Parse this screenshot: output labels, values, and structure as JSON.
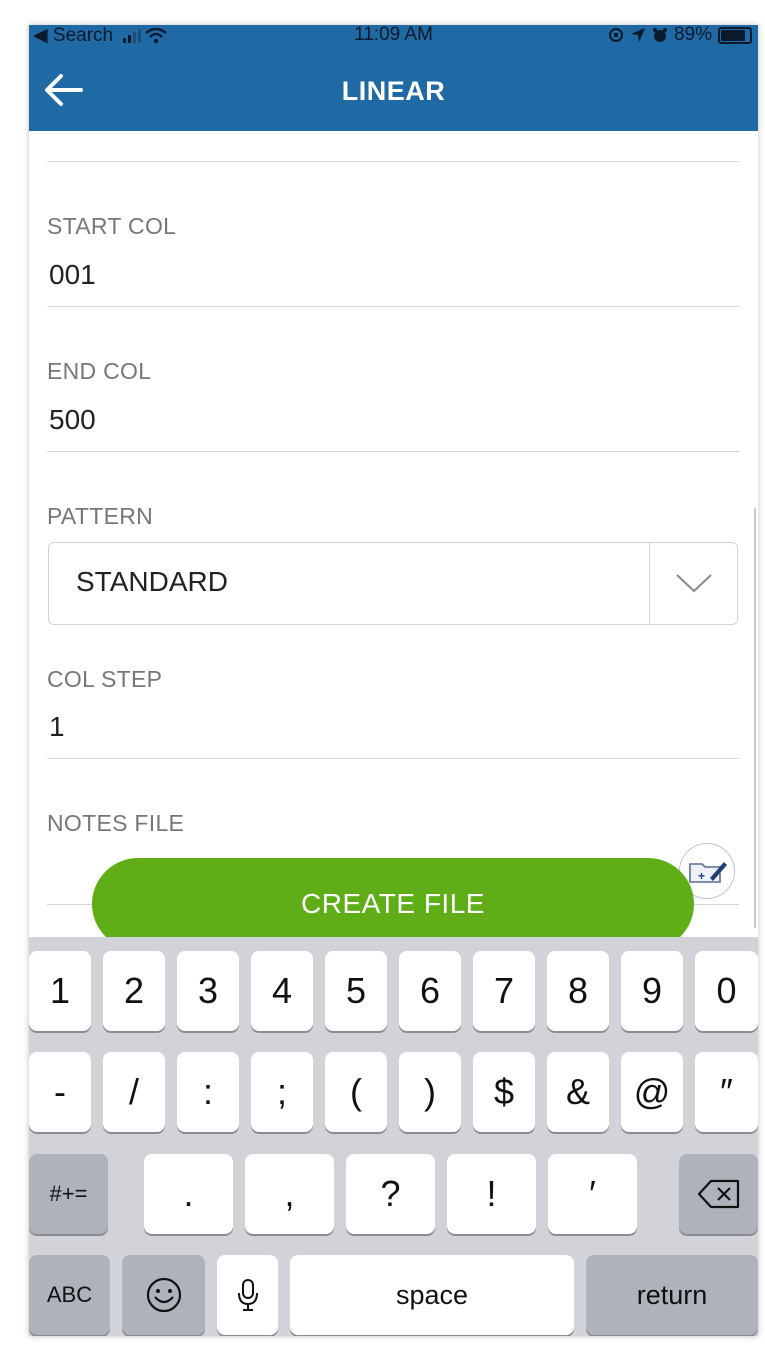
{
  "status_bar": {
    "back_app": "◀ Search",
    "time": "11:09 AM",
    "battery": "89%"
  },
  "header": {
    "title": "LINEAR"
  },
  "form": {
    "start_col": {
      "label": "START COL",
      "value": "001"
    },
    "end_col": {
      "label": "END COL",
      "value": "500"
    },
    "pattern": {
      "label": "PATTERN",
      "value": "STANDARD"
    },
    "col_step": {
      "label": "COL STEP",
      "value": "1"
    },
    "notes_file": {
      "label": "NOTES FILE",
      "value": ""
    }
  },
  "actions": {
    "create_file": "CREATE FILE"
  },
  "keyboard": {
    "row1": [
      "1",
      "2",
      "3",
      "4",
      "5",
      "6",
      "7",
      "8",
      "9",
      "0"
    ],
    "row2": [
      "-",
      "/",
      ":",
      ";",
      "(",
      ")",
      "$",
      "&",
      "@",
      "″"
    ],
    "row3": [
      ".",
      ",",
      "?",
      "!",
      "′"
    ],
    "mode_symbols": "#+=",
    "mode_abc": "ABC",
    "space": "space",
    "return": "return"
  }
}
